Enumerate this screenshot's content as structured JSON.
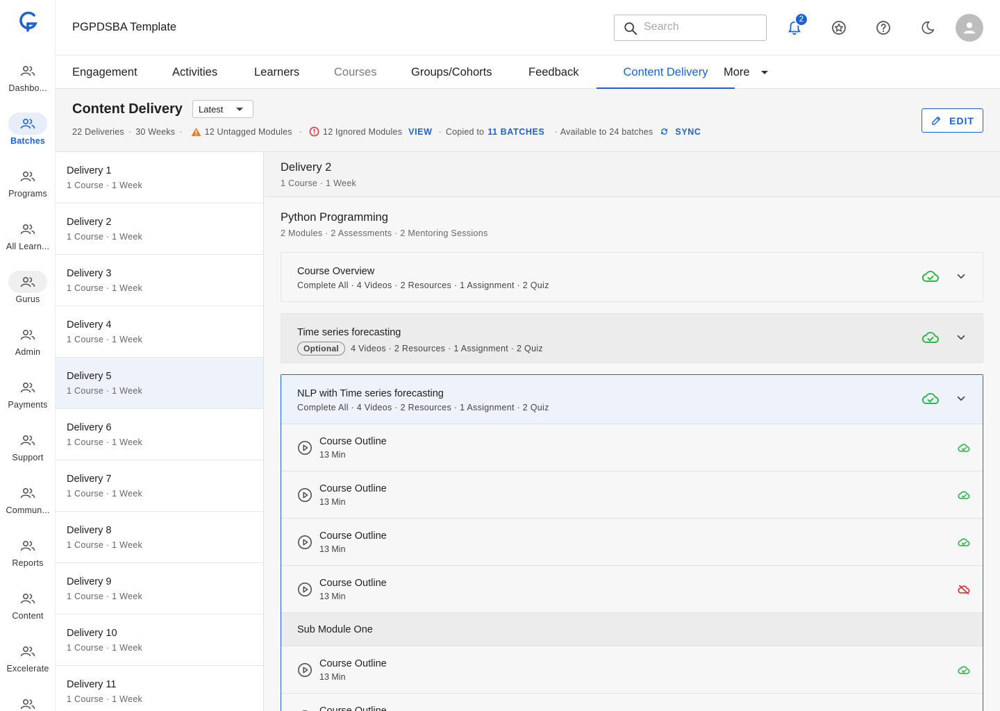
{
  "app": {
    "title": "PGPDSBA Template",
    "accent": "#1a63d6",
    "success": "#2eb84a",
    "error": "#e0322e"
  },
  "sidebar": {
    "logo_icon": "g-logo-icon",
    "items": [
      {
        "label": "Dashbo...",
        "icon": "people-icon"
      },
      {
        "label": "Batches",
        "icon": "people-icon",
        "active": true
      },
      {
        "label": "Programs",
        "icon": "people-icon"
      },
      {
        "label": "All Learn...",
        "icon": "people-icon"
      },
      {
        "label": "Gurus",
        "icon": "people-icon"
      },
      {
        "label": "Admin",
        "icon": "people-icon"
      },
      {
        "label": "Payments",
        "icon": "people-icon"
      },
      {
        "label": "Support",
        "icon": "people-icon"
      },
      {
        "label": "Commun...",
        "icon": "people-icon"
      },
      {
        "label": "Reports",
        "icon": "people-icon"
      },
      {
        "label": "Content",
        "icon": "people-icon"
      },
      {
        "label": "Excelerate",
        "icon": "people-icon"
      },
      {
        "label": "",
        "icon": "people-icon"
      }
    ]
  },
  "header": {
    "search_placeholder": "Search",
    "notification_count": "2",
    "icons": [
      "bell-icon",
      "star-badge-icon",
      "help-icon",
      "dark-mode-icon",
      "avatar-icon"
    ]
  },
  "tabs": [
    {
      "label": "Engagement"
    },
    {
      "label": "Activities"
    },
    {
      "label": "Learners"
    },
    {
      "label": "Courses",
      "disabled": true
    },
    {
      "label": "Groups/Cohorts"
    },
    {
      "label": "Feedback"
    },
    {
      "label": "Content Delivery",
      "active": true
    },
    {
      "label": "More",
      "dropdown": true
    }
  ],
  "page": {
    "title": "Content Delivery",
    "version_select": "Latest",
    "meta": {
      "deliveries": "22 Deliveries",
      "weeks": "30 Weeks",
      "untagged": "12 Untagged Modules",
      "ignored": "12 Ignored Modules",
      "view_link": "VIEW",
      "copied_prefix": "Copied to",
      "copied_link": "11 BATCHES",
      "available": "Available to 24 batches",
      "sync_link": "SYNC"
    },
    "edit_label": "EDIT"
  },
  "deliveries": [
    {
      "name": "Delivery 1",
      "meta": "1 Course · 1 Week"
    },
    {
      "name": "Delivery 2",
      "meta": "1 Course · 1 Week"
    },
    {
      "name": "Delivery 3",
      "meta": "1 Course · 1 Week"
    },
    {
      "name": "Delivery 4",
      "meta": "1 Course · 1 Week"
    },
    {
      "name": "Delivery 5",
      "meta": "1 Course · 1 Week",
      "selected": true
    },
    {
      "name": "Delivery 6",
      "meta": "1 Course · 1 Week"
    },
    {
      "name": "Delivery 7",
      "meta": "1 Course · 1 Week"
    },
    {
      "name": "Delivery 8",
      "meta": "1 Course · 1 Week"
    },
    {
      "name": "Delivery 9",
      "meta": "1 Course · 1 Week"
    },
    {
      "name": "Delivery 10",
      "meta": "1 Course · 1 Week"
    },
    {
      "name": "Delivery 11",
      "meta": "1 Course · 1 Week"
    }
  ],
  "detail": {
    "title": "Delivery 2",
    "meta": "1 Course · 1 Week",
    "course": {
      "title": "Python Programming",
      "meta": "2 Modules · 2 Assessments · 2 Mentoring Sessions"
    },
    "modules": [
      {
        "title": "Course Overview",
        "meta": "Complete All · 4 Videos  · 2 Resources · 1 Assignment · 2 Quiz",
        "chip": ""
      },
      {
        "title": "Time series forecasting",
        "meta": "4 Videos  · 2 Resources · 1 Assignment · 2 Quiz",
        "chip": "Optional"
      }
    ],
    "expanded": {
      "title": "NLP with Time series forecasting",
      "meta": "Complete All · 4 Videos  · 2 Resources · 1 Assignment · 2 Quiz",
      "resources": [
        {
          "title": "Course Outline",
          "duration": "13 Min",
          "synced": true
        },
        {
          "title": "Course Outline",
          "duration": "13 Min",
          "synced": true
        },
        {
          "title": "Course Outline",
          "duration": "13 Min",
          "synced": true
        },
        {
          "title": "Course Outline",
          "duration": "13 Min",
          "synced": false
        }
      ],
      "submodule": "Sub Module One",
      "sub_resources": [
        {
          "title": "Course Outline",
          "duration": "13 Min",
          "synced": true
        },
        {
          "title": "Course Outline",
          "duration": "",
          "synced": true
        }
      ]
    }
  }
}
